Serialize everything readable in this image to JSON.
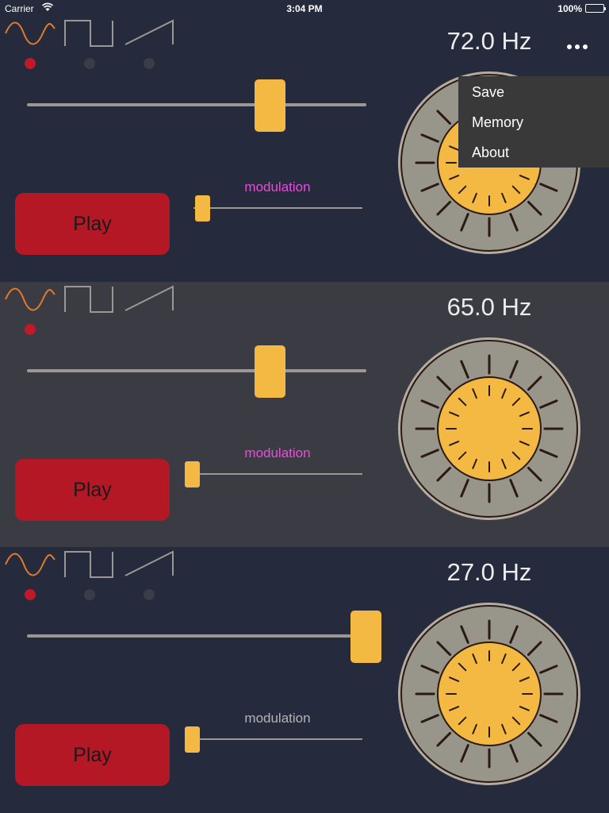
{
  "status_bar": {
    "carrier": "Carrier",
    "time": "3:04 PM",
    "battery": "100%"
  },
  "menu": {
    "items": [
      "Save",
      "Memory",
      "About"
    ]
  },
  "oscillators": [
    {
      "frequency": "72.0 Hz",
      "waveform": "sine",
      "frequency_level": 0.705,
      "modulation_label": "modulation",
      "modulation_color": "#e54fd8",
      "modulation_level": 0.06,
      "play_label": "Play"
    },
    {
      "frequency": "65.0 Hz",
      "waveform": "sine",
      "frequency_level": 0.705,
      "modulation_label": "modulation",
      "modulation_color": "#e54fd8",
      "modulation_level": 0.0,
      "play_label": "Play"
    },
    {
      "frequency": "27.0 Hz",
      "waveform": "sine",
      "frequency_level": 1.0,
      "modulation_label": "modulation",
      "modulation_color": "#b4b4b4",
      "modulation_level": 0.0,
      "play_label": "Play"
    }
  ],
  "colors": {
    "accent": "#f4b942",
    "play": "#b41825",
    "active_dot": "#c0192a",
    "wave_sine": "#e07b2b",
    "wave_inactive": "#9b9893"
  }
}
